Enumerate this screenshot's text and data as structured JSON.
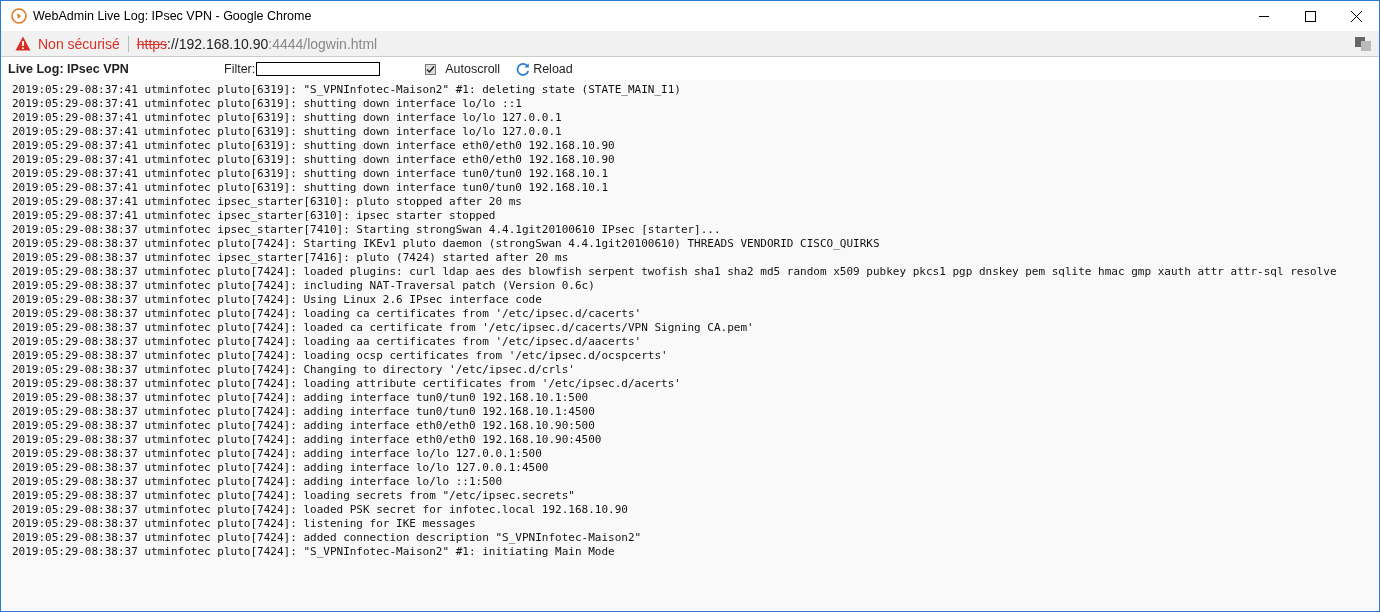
{
  "window": {
    "title": "WebAdmin Live Log: IPsec VPN - Google Chrome"
  },
  "address_bar": {
    "security": "Non sécurisé",
    "scheme": "https",
    "host": "://192.168.10.90",
    "port": ":4444",
    "path": "/logwin.html"
  },
  "toolbar": {
    "title": "Live Log: IPsec VPN",
    "filter_label": "Filter:",
    "autoscroll": {
      "label": "Autoscroll",
      "checked": true
    },
    "reload": "Reload"
  },
  "log_lines": [
    "2019:05:29-08:37:41 utminfotec pluto[6319]: \"S_VPNInfotec-Maison2\" #1: deleting state (STATE_MAIN_I1)",
    "2019:05:29-08:37:41 utminfotec pluto[6319]: shutting down interface lo/lo ::1",
    "2019:05:29-08:37:41 utminfotec pluto[6319]: shutting down interface lo/lo 127.0.0.1",
    "2019:05:29-08:37:41 utminfotec pluto[6319]: shutting down interface lo/lo 127.0.0.1",
    "2019:05:29-08:37:41 utminfotec pluto[6319]: shutting down interface eth0/eth0 192.168.10.90",
    "2019:05:29-08:37:41 utminfotec pluto[6319]: shutting down interface eth0/eth0 192.168.10.90",
    "2019:05:29-08:37:41 utminfotec pluto[6319]: shutting down interface tun0/tun0 192.168.10.1",
    "2019:05:29-08:37:41 utminfotec pluto[6319]: shutting down interface tun0/tun0 192.168.10.1",
    "2019:05:29-08:37:41 utminfotec ipsec_starter[6310]: pluto stopped after 20 ms",
    "2019:05:29-08:37:41 utminfotec ipsec_starter[6310]: ipsec starter stopped",
    "2019:05:29-08:38:37 utminfotec ipsec_starter[7410]: Starting strongSwan 4.4.1git20100610 IPsec [starter]...",
    "2019:05:29-08:38:37 utminfotec pluto[7424]: Starting IKEv1 pluto daemon (strongSwan 4.4.1git20100610) THREADS VENDORID CISCO_QUIRKS",
    "2019:05:29-08:38:37 utminfotec ipsec_starter[7416]: pluto (7424) started after 20 ms",
    "2019:05:29-08:38:37 utminfotec pluto[7424]: loaded plugins: curl ldap aes des blowfish serpent twofish sha1 sha2 md5 random x509 pubkey pkcs1 pgp dnskey pem sqlite hmac gmp xauth attr attr-sql resolve",
    "2019:05:29-08:38:37 utminfotec pluto[7424]: including NAT-Traversal patch (Version 0.6c)",
    "2019:05:29-08:38:37 utminfotec pluto[7424]: Using Linux 2.6 IPsec interface code",
    "2019:05:29-08:38:37 utminfotec pluto[7424]: loading ca certificates from '/etc/ipsec.d/cacerts'",
    "2019:05:29-08:38:37 utminfotec pluto[7424]: loaded ca certificate from '/etc/ipsec.d/cacerts/VPN Signing CA.pem'",
    "2019:05:29-08:38:37 utminfotec pluto[7424]: loading aa certificates from '/etc/ipsec.d/aacerts'",
    "2019:05:29-08:38:37 utminfotec pluto[7424]: loading ocsp certificates from '/etc/ipsec.d/ocspcerts'",
    "2019:05:29-08:38:37 utminfotec pluto[7424]: Changing to directory '/etc/ipsec.d/crls'",
    "2019:05:29-08:38:37 utminfotec pluto[7424]: loading attribute certificates from '/etc/ipsec.d/acerts'",
    "2019:05:29-08:38:37 utminfotec pluto[7424]: adding interface tun0/tun0 192.168.10.1:500",
    "2019:05:29-08:38:37 utminfotec pluto[7424]: adding interface tun0/tun0 192.168.10.1:4500",
    "2019:05:29-08:38:37 utminfotec pluto[7424]: adding interface eth0/eth0 192.168.10.90:500",
    "2019:05:29-08:38:37 utminfotec pluto[7424]: adding interface eth0/eth0 192.168.10.90:4500",
    "2019:05:29-08:38:37 utminfotec pluto[7424]: adding interface lo/lo 127.0.0.1:500",
    "2019:05:29-08:38:37 utminfotec pluto[7424]: adding interface lo/lo 127.0.0.1:4500",
    "2019:05:29-08:38:37 utminfotec pluto[7424]: adding interface lo/lo ::1:500",
    "2019:05:29-08:38:37 utminfotec pluto[7424]: loading secrets from \"/etc/ipsec.secrets\"",
    "2019:05:29-08:38:37 utminfotec pluto[7424]: loaded PSK secret for infotec.local 192.168.10.90",
    "2019:05:29-08:38:37 utminfotec pluto[7424]: listening for IKE messages",
    "2019:05:29-08:38:37 utminfotec pluto[7424]: added connection description \"S_VPNInfotec-Maison2\"",
    "2019:05:29-08:38:37 utminfotec pluto[7424]: \"S_VPNInfotec-Maison2\" #1: initiating Main Mode"
  ]
}
